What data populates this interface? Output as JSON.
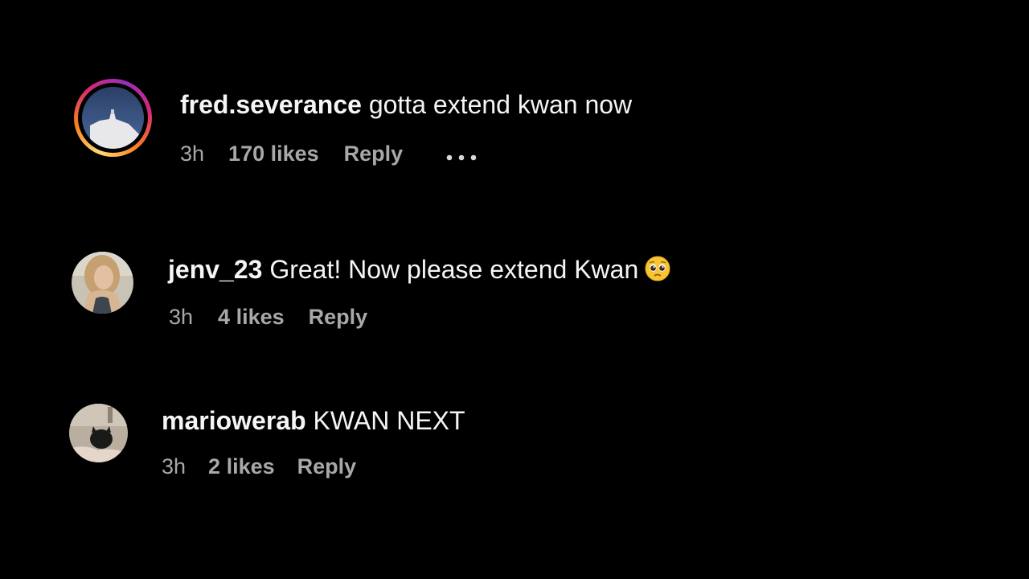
{
  "comments": [
    {
      "username": "fred.severance",
      "text": "gotta extend kwan now",
      "time": "3h",
      "likes": "170 likes",
      "reply": "Reply",
      "has_story_ring": true,
      "more_icon": "more-horizontal-icon"
    },
    {
      "username": "jenv_23",
      "text": "Great! Now please extend Kwan",
      "emoji": "pleading-face-emoji",
      "time": "3h",
      "likes": "4 likes",
      "reply": "Reply",
      "has_story_ring": false
    },
    {
      "username": "mariowerab",
      "text": "KWAN NEXT",
      "time": "3h",
      "likes": "2 likes",
      "reply": "Reply",
      "has_story_ring": false
    }
  ],
  "colors": {
    "background": "#000000",
    "primary_text": "#f5f5f5",
    "secondary_text": "#a8a8a8"
  }
}
